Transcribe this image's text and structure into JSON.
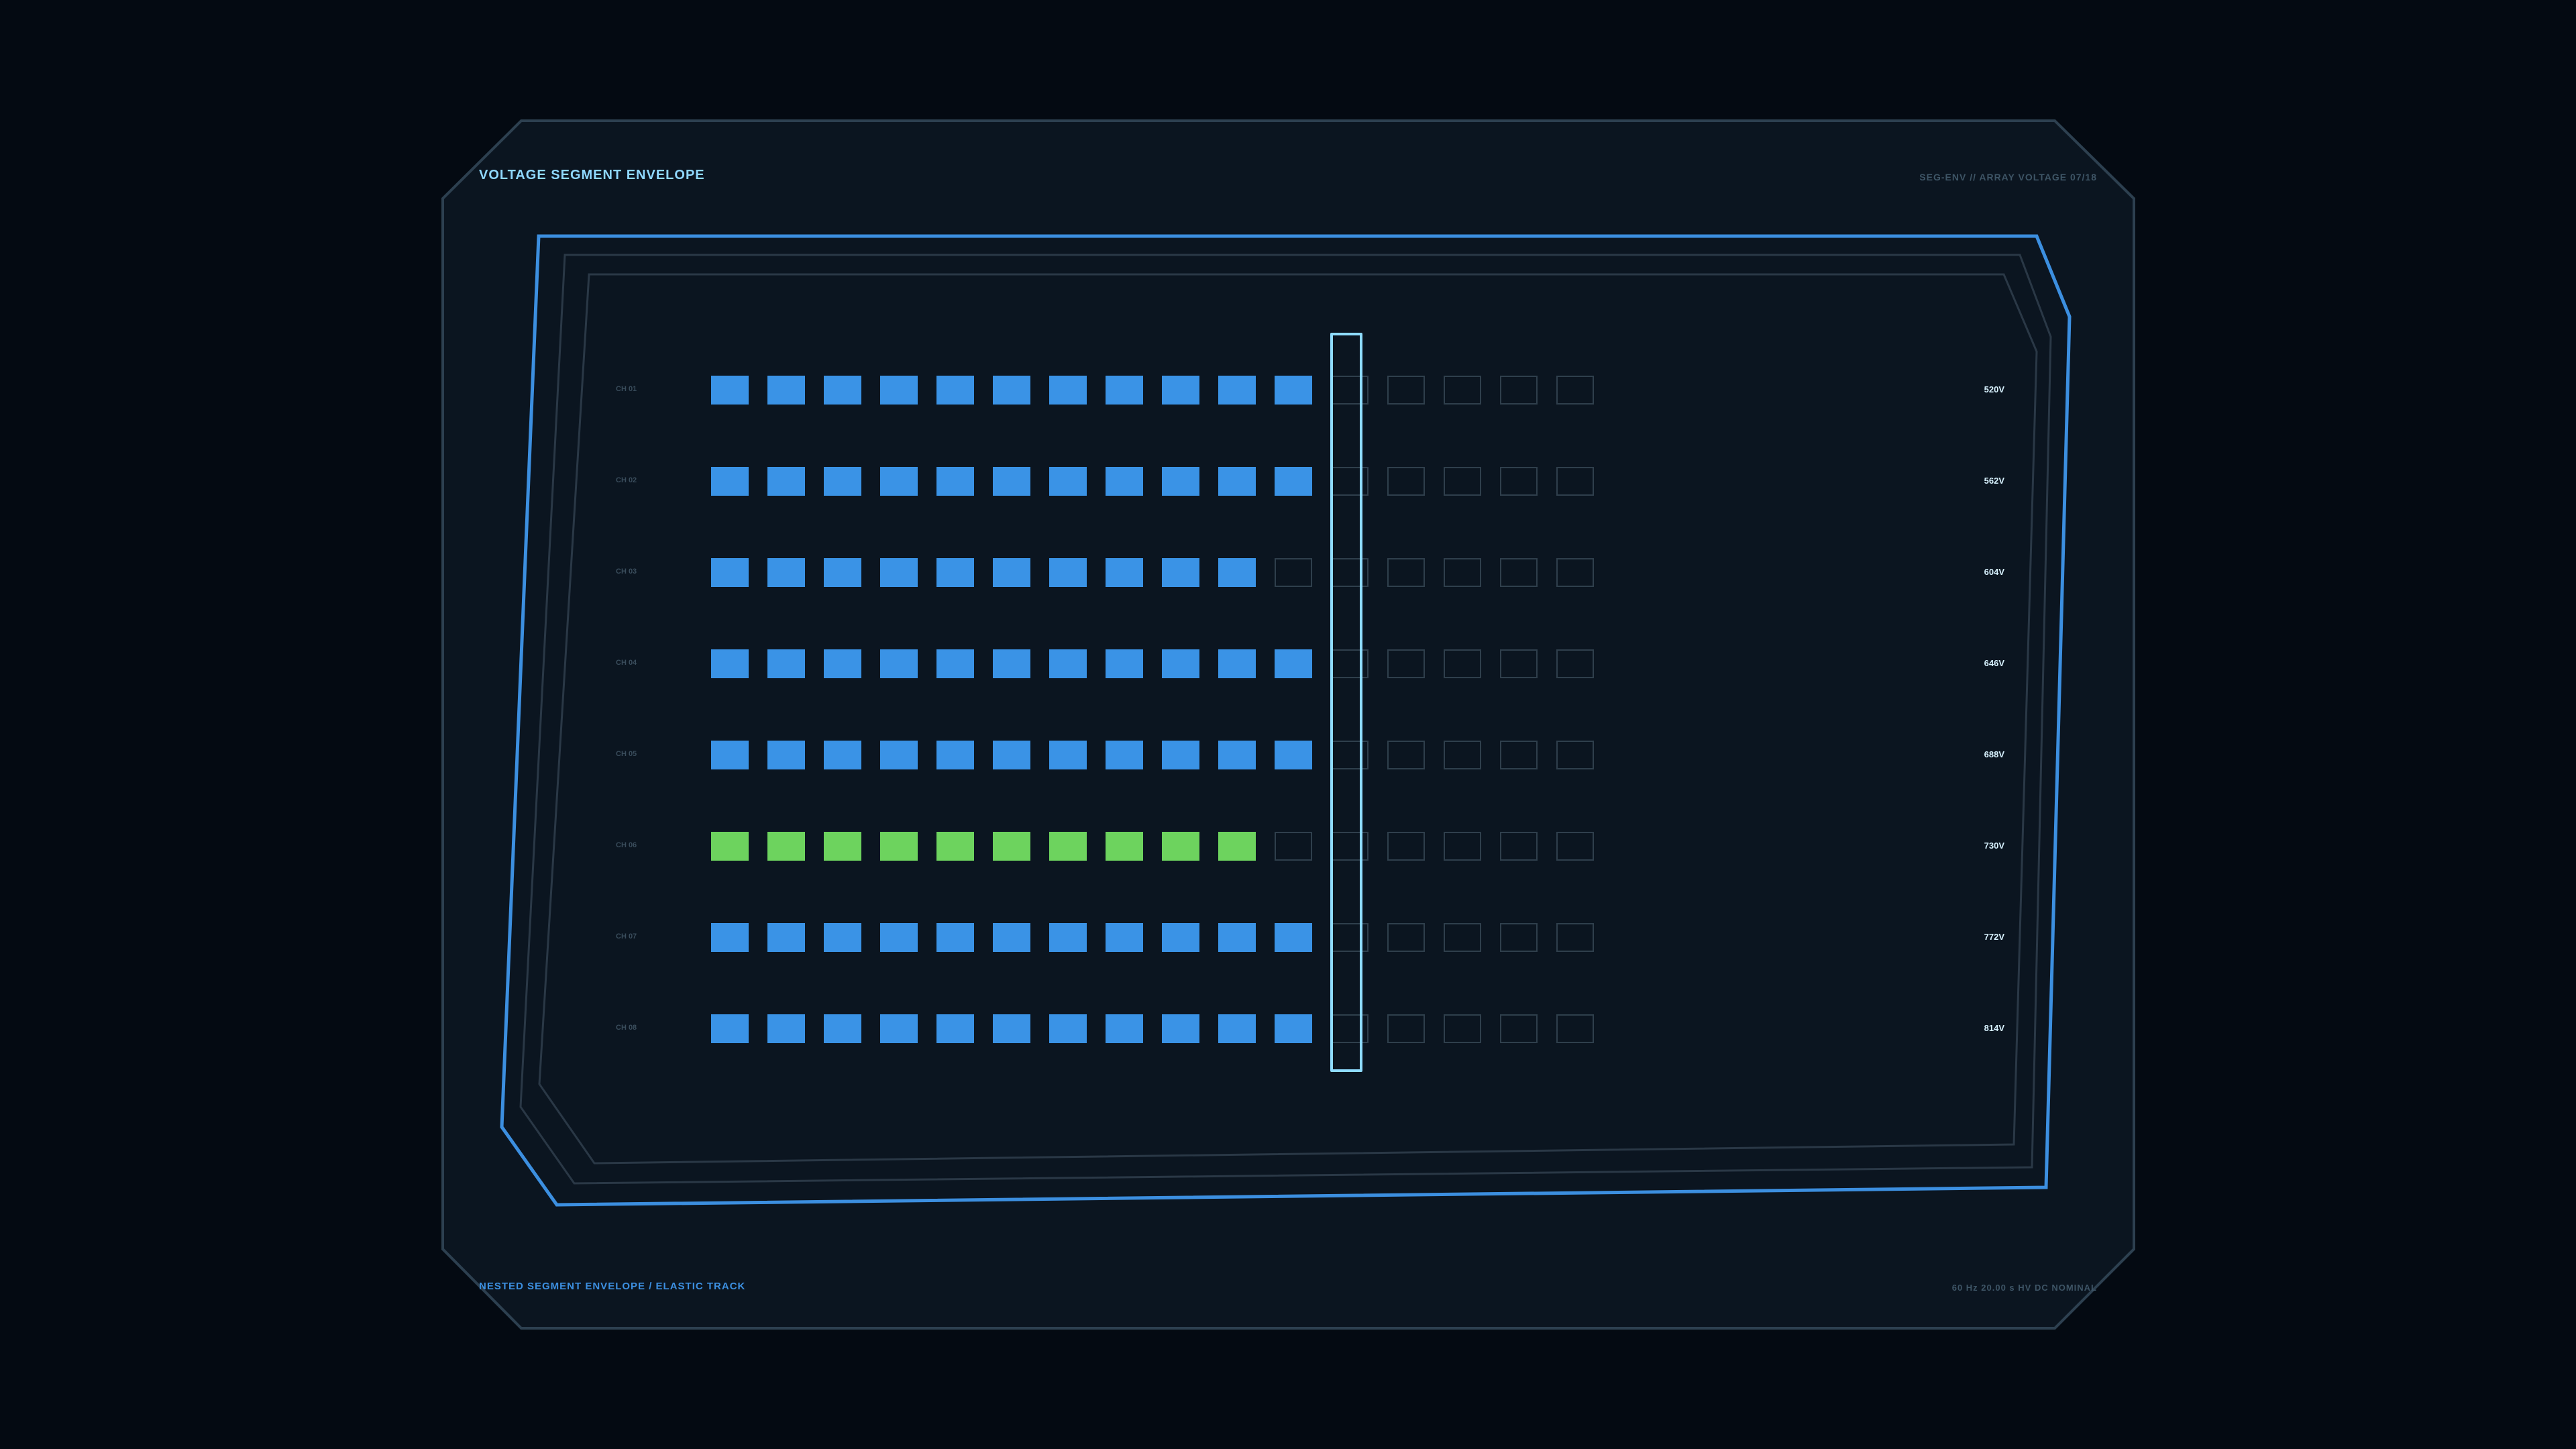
{
  "panel": {
    "title": "VOLTAGE SEGMENT ENVELOPE",
    "code": "SEG-ENV // ARRAY VOLTAGE 07/18",
    "footer_left": "NESTED SEGMENT ENVELOPE / ELASTIC TRACK",
    "footer_right": "60 Hz  20.00 s  HV DC NOMINAL"
  },
  "colors": {
    "frame_border": "#2d4050",
    "envelope_outer": "#3c8fe0",
    "envelope_inner": "#2a3846",
    "segment_active": "#3a93e6",
    "segment_highlight": "#6dd35e",
    "segment_off": "#2f3f4c",
    "cursor": "#8fdcff"
  },
  "segments_per_row": 16,
  "cursor_segment": 12,
  "rows": [
    {
      "label": "CH 01",
      "voltage": "520V",
      "active": 11,
      "state": "normal"
    },
    {
      "label": "CH 02",
      "voltage": "562V",
      "active": 11,
      "state": "normal"
    },
    {
      "label": "CH 03",
      "voltage": "604V",
      "active": 10,
      "state": "normal"
    },
    {
      "label": "CH 04",
      "voltage": "646V",
      "active": 11,
      "state": "normal"
    },
    {
      "label": "CH 05",
      "voltage": "688V",
      "active": 11,
      "state": "normal"
    },
    {
      "label": "CH 06",
      "voltage": "730V",
      "active": 10,
      "state": "highlight"
    },
    {
      "label": "CH 07",
      "voltage": "772V",
      "active": 11,
      "state": "normal"
    },
    {
      "label": "CH 08",
      "voltage": "814V",
      "active": 11,
      "state": "normal"
    }
  ]
}
